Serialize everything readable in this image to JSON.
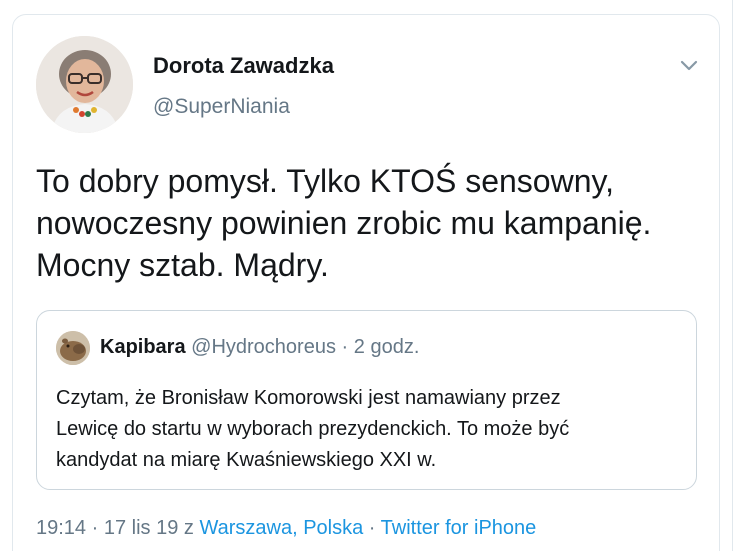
{
  "tweet": {
    "author": {
      "display_name": "Dorota Zawadzka",
      "handle": "@SuperNiania"
    },
    "text_lines": [
      "To dobry pomysł. Tylko KTOŚ sensowny,",
      "nowoczesny powinien zrobic mu kampanię.",
      "Mocny sztab. Mądry."
    ],
    "quoted": {
      "display_name": "Kapibara",
      "handle": "@Hydrochoreus",
      "separator": "·",
      "time": "2 godz.",
      "text_lines": [
        "Czytam, że Bronisław Komorowski jest namawiany przez",
        "Lewicę do startu w wyborach prezydenckich. To może być",
        "kandydat na miarę Kwaśniewskiego XXI w."
      ]
    },
    "meta": {
      "time": "19:14",
      "sep1": "·",
      "date": "17 lis 19",
      "from_word": "z",
      "location": "Warszawa, Polska",
      "sep2": "·",
      "source": "Twitter for iPhone"
    }
  },
  "icons": {
    "menu": "chevron-down-icon"
  },
  "colors": {
    "text": "#14171a",
    "secondary": "#657786",
    "link": "#1b95e0",
    "border": "#e1e8ed"
  }
}
